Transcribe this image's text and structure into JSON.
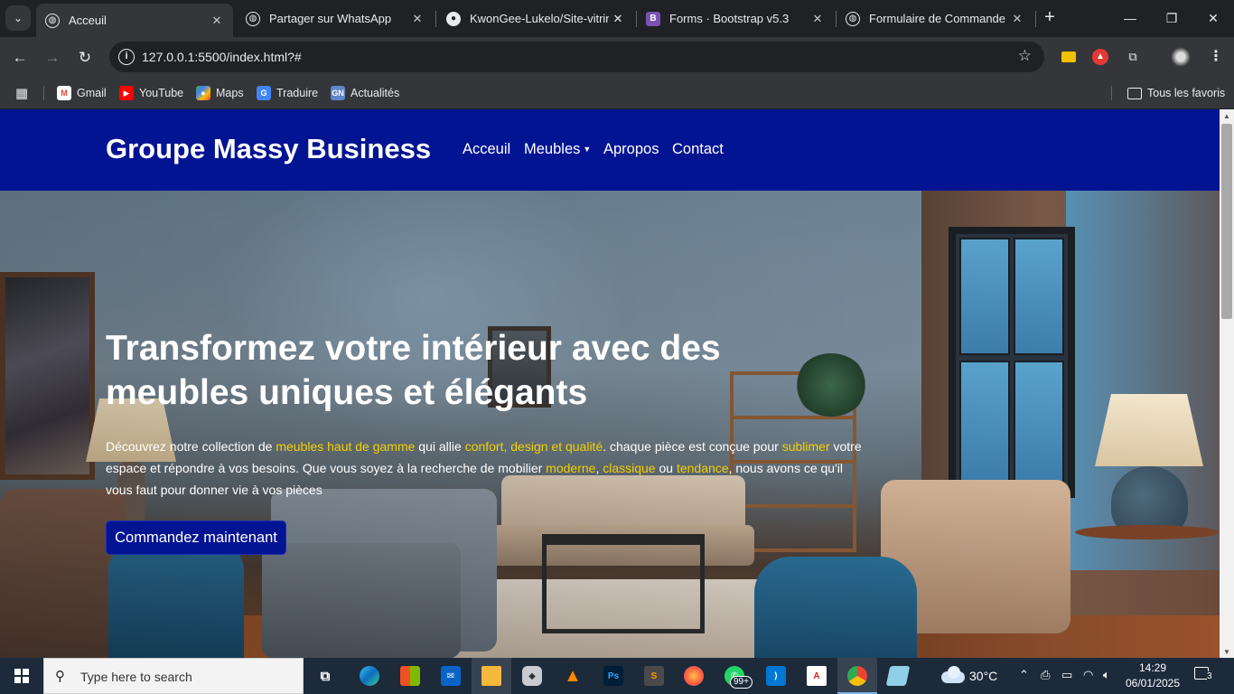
{
  "browser": {
    "tabs": [
      {
        "title": "Acceuil",
        "active": true
      },
      {
        "title": "Partager sur WhatsApp",
        "active": false
      },
      {
        "title": "KwonGee-Lukelo/Site-vitrine",
        "active": false
      },
      {
        "title": "Forms · Bootstrap v5.3",
        "active": false
      },
      {
        "title": "Formulaire de Commande",
        "active": false
      }
    ],
    "url": "127.0.0.1:5500/index.html?#",
    "bookmarks": [
      "Gmail",
      "YouTube",
      "Maps",
      "Traduire",
      "Actualités"
    ],
    "all_bookmarks_label": "Tous les favoris",
    "profile_menu_count": "3"
  },
  "site": {
    "brand": "Groupe Massy Business",
    "nav": {
      "home": "Acceuil",
      "furniture": "Meubles",
      "about": "Apropos",
      "contact": "Contact"
    },
    "hero": {
      "title": "Transformez votre intérieur avec des meubles uniques et élégants",
      "text": {
        "p1": "Découvrez notre collection de ",
        "h1": "meubles haut de gamme",
        "p2": " qui allie ",
        "h2": "confort, design et qualité",
        "p3": ". chaque pièce est conçue pour ",
        "h3": "sublimer",
        "p4": " votre espace et répondre à vos besoins. Que vous soyez à la recherche de mobilier ",
        "h4": "moderne",
        "p5": ", ",
        "h5": "classique",
        "p6": " ou ",
        "h6": "tendance",
        "p7": ", nous avons ce qu'il vous faut pour donner vie à vos pièces"
      },
      "cta": "Commandez maintenant"
    },
    "colors": {
      "navbar": "#031493",
      "highlight": "#f5d100"
    }
  },
  "taskbar": {
    "search_placeholder": "Type here to search",
    "whatsapp_badge": "99+",
    "temperature": "30°C",
    "time": "14:29",
    "date": "06/01/2025",
    "notifications": "3"
  }
}
